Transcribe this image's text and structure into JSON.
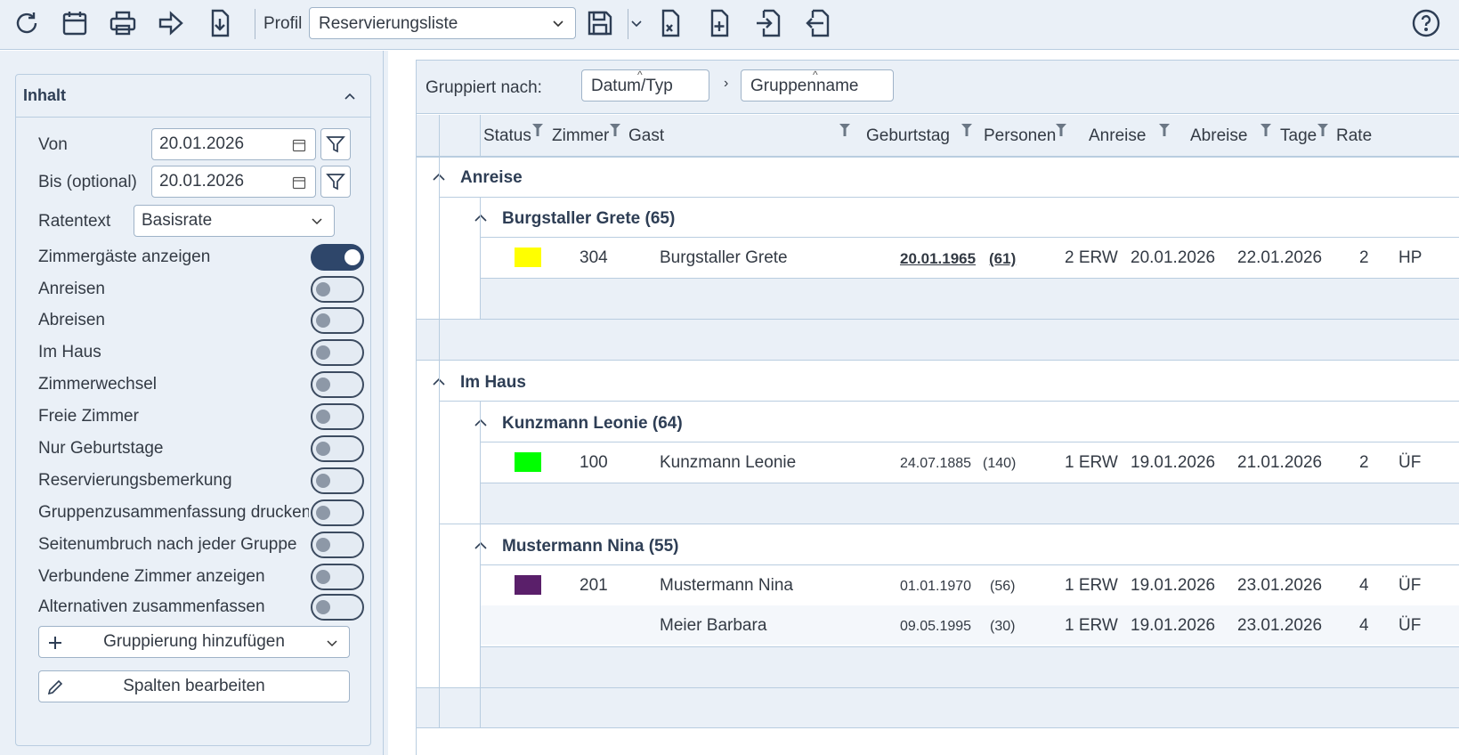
{
  "toolbar": {
    "icons": [
      "refresh-icon",
      "calendar-icon",
      "printer-icon",
      "forward-arrow-icon",
      "download-icon",
      "save-icon",
      "excel-export-icon",
      "add-file-icon",
      "import-icon",
      "export-icon",
      "help-icon"
    ],
    "profil_label": "Profil",
    "profil_value": "Reservierungsliste"
  },
  "panel": {
    "title": "Inhalt",
    "von_label": "Von",
    "von_value": "20.01.2026",
    "bis_label": "Bis (optional)",
    "bis_value": "20.01.2026",
    "ratentext_label": "Ratentext",
    "ratentext_value": "Basisrate",
    "toggles": [
      {
        "label": "Zimmergäste anzeigen",
        "on": true
      },
      {
        "label": "Anreisen",
        "on": false
      },
      {
        "label": "Abreisen",
        "on": false
      },
      {
        "label": "Im Haus",
        "on": false
      },
      {
        "label": "Zimmerwechsel",
        "on": false
      },
      {
        "label": "Freie Zimmer",
        "on": false
      },
      {
        "label": "Nur Geburtstage",
        "on": false
      },
      {
        "label": "Reservierungsbemerkung",
        "on": false
      },
      {
        "label": "Gruppenzusammenfassung drucken",
        "on": false
      },
      {
        "label": "Seitenumbruch nach jeder Gruppe",
        "on": false
      },
      {
        "label": "Verbundene Zimmer anzeigen",
        "on": false
      },
      {
        "label": "Alternativen zusammenfassen",
        "on": false
      }
    ],
    "add_grouping": "Gruppierung hinzufügen",
    "edit_columns": "Spalten bearbeiten"
  },
  "grid": {
    "grouped_by_label": "Gruppiert nach:",
    "group_chips": [
      "Datum/Typ",
      "Gruppenname"
    ],
    "columns": [
      "Status",
      "Zimmer",
      "Gast",
      "Geburtstag",
      "Personen",
      "Anreise",
      "Abreise",
      "Tage",
      "Rate"
    ],
    "groups": [
      {
        "title": "Anreise",
        "subgroups": [
          {
            "title": "Burgstaller Grete (65)",
            "rows": [
              {
                "status_color": "#ffff00",
                "zimmer": "304",
                "gast": "Burgstaller Grete",
                "geburtstag": "20.01.1965",
                "alter": "(61)",
                "personen": "2 ERW",
                "anreise": "20.01.2026",
                "abreise": "22.01.2026",
                "tage": "2",
                "rate": "HP"
              }
            ]
          }
        ]
      },
      {
        "title": "Im Haus",
        "subgroups": [
          {
            "title": "Kunzmann Leonie (64)",
            "rows": [
              {
                "status_color": "#00ff00",
                "zimmer": "100",
                "gast": "Kunzmann Leonie",
                "geburtstag": "24.07.1885",
                "alter": "(140)",
                "personen": "1 ERW",
                "anreise": "19.01.2026",
                "abreise": "21.01.2026",
                "tage": "2",
                "rate": "ÜF"
              }
            ]
          },
          {
            "title": "Mustermann Nina (55)",
            "rows": [
              {
                "status_color": "#5a1f6a",
                "zimmer": "201",
                "gast": "Mustermann Nina",
                "geburtstag": "01.01.1970",
                "alter": "(56)",
                "personen": "1 ERW",
                "anreise": "19.01.2026",
                "abreise": "23.01.2026",
                "tage": "4",
                "rate": "ÜF"
              },
              {
                "status_color": "",
                "zimmer": "",
                "gast": "Meier Barbara",
                "geburtstag": "09.05.1995",
                "alter": "(30)",
                "personen": "1 ERW",
                "anreise": "19.01.2026",
                "abreise": "23.01.2026",
                "tage": "4",
                "rate": "ÜF"
              }
            ]
          }
        ]
      }
    ]
  }
}
